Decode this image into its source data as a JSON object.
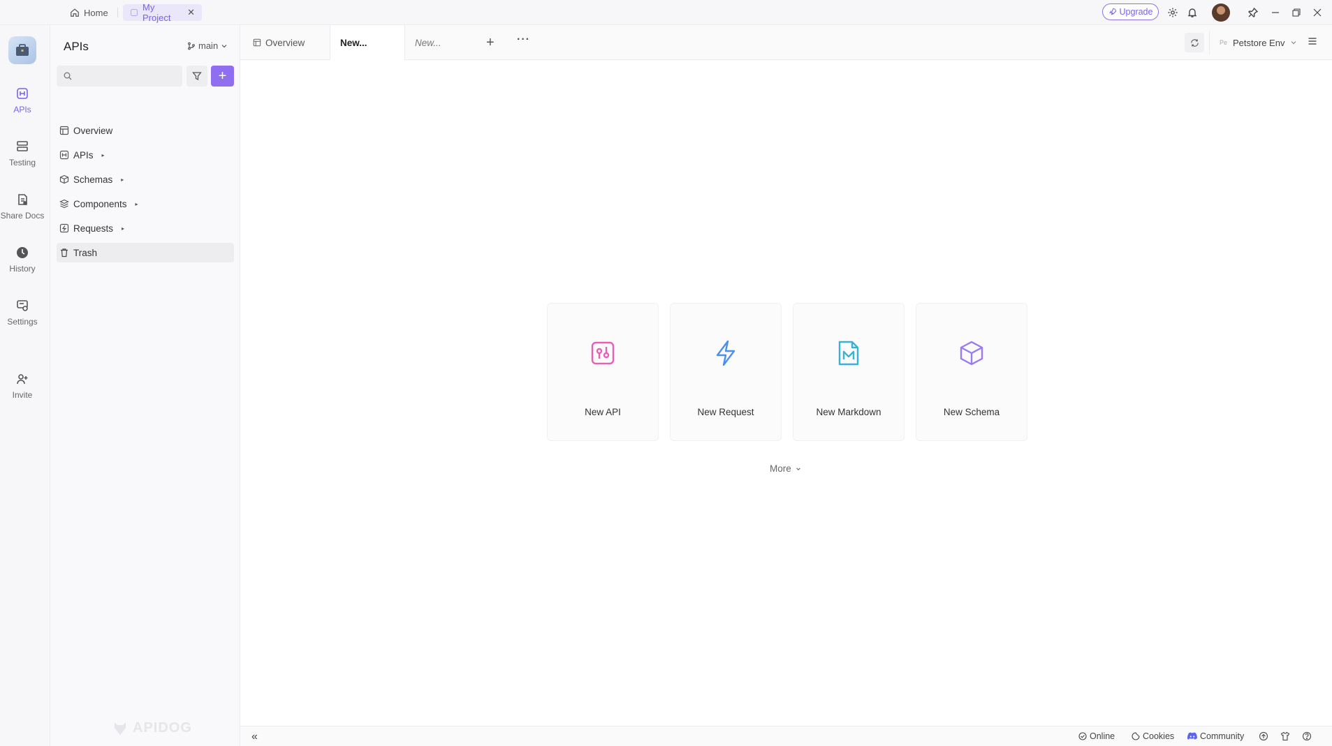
{
  "titlebar": {
    "home_label": "Home",
    "project_label": "My Project",
    "upgrade_label": "Upgrade"
  },
  "rail": {
    "items": [
      {
        "label": "APIs",
        "icon": "api-icon"
      },
      {
        "label": "Testing",
        "icon": "testing-icon"
      },
      {
        "label": "Share Docs",
        "icon": "share-docs-icon"
      },
      {
        "label": "History",
        "icon": "history-icon"
      },
      {
        "label": "Settings",
        "icon": "settings-icon"
      },
      {
        "label": "Invite",
        "icon": "invite-icon"
      }
    ]
  },
  "sidebar": {
    "title": "APIs",
    "branch": "main",
    "search_placeholder": "",
    "items": [
      {
        "label": "Overview",
        "icon": "overview-icon"
      },
      {
        "label": "APIs",
        "icon": "api-icon"
      },
      {
        "label": "Schemas",
        "icon": "schema-icon"
      },
      {
        "label": "Components",
        "icon": "components-icon"
      },
      {
        "label": "Requests",
        "icon": "requests-icon"
      },
      {
        "label": "Trash",
        "icon": "trash-icon"
      }
    ],
    "watermark": "APIDOG"
  },
  "tabs": {
    "items": [
      {
        "label": "Overview"
      },
      {
        "label": "New..."
      },
      {
        "label": "New..."
      }
    ],
    "environment": "Petstore Env",
    "env_badge": "Pe"
  },
  "main": {
    "cards": [
      {
        "label": "New API",
        "icon": "new-api-icon",
        "color": "#e85fb8"
      },
      {
        "label": "New Request",
        "icon": "lightning-icon",
        "color": "#4a8ff0"
      },
      {
        "label": "New Markdown",
        "icon": "markdown-icon",
        "color": "#36b3d6"
      },
      {
        "label": "New Schema",
        "icon": "cube-icon",
        "color": "#9a7bf0"
      }
    ],
    "more_label": "More"
  },
  "status": {
    "online": "Online",
    "cookies": "Cookies",
    "community": "Community"
  },
  "colors": {
    "accent": "#8f6ff0",
    "accent_light": "#ebe7fb"
  }
}
